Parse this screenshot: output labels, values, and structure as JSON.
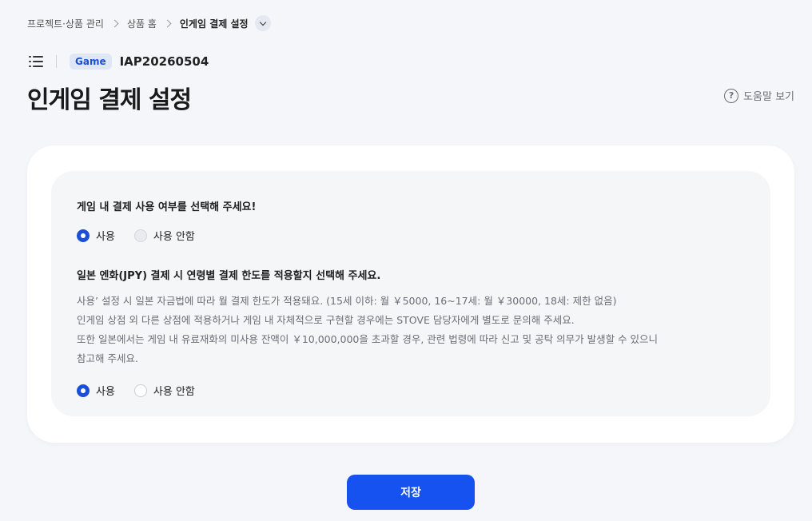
{
  "breadcrumb": {
    "items": [
      "프로젝트·상품 관리",
      "상품 홈"
    ],
    "current": "인게임 결제 설정"
  },
  "header": {
    "badge": "Game",
    "product_id": "IAP20260504",
    "title": "인게임 결제 설정",
    "help": "도움말 보기"
  },
  "q1": {
    "title": "게임 내 결제 사용 여부를 선택해 주세요!",
    "options": [
      "사용",
      "사용 안함"
    ],
    "selected": "사용"
  },
  "q2": {
    "title": "일본 엔화(JPY) 결제 시 연령별 결제 한도를 적용할지 선택해 주세요.",
    "desc": [
      "사용’ 설정 시 일본 자금법에 따라 월 결제 한도가 적용돼요. (15세 이하: 월 ￥5000, 16~17세: 월 ￥30000, 18세: 제한 없음)",
      "인게임 상점 외 다른 상점에 적용하거나 게임 내 자체적으로 구현할 경우에는 STOVE 담당자에게 별도로 문의해 주세요.",
      "또한 일본에서는 게임 내 유료재화의 미사용 잔액이 ￥10,000,000을 초과할 경우, 관련 법령에 따라 신고 및 공탁 의무가 발생할 수 있으니",
      "참고해 주세요."
    ],
    "options": [
      "사용",
      "사용 안함"
    ],
    "selected": "사용"
  },
  "save_label": "저장",
  "colors": {
    "accent": "#1652f0",
    "background": "#f4f6fa"
  }
}
